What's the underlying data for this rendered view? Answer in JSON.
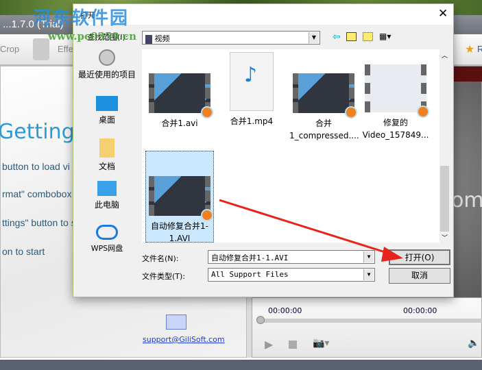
{
  "app": {
    "title": "...1.7.0 (Trial)",
    "toolbar": [
      "Crop",
      "Effect",
      "R"
    ],
    "getting_started": "Getting Started",
    "steps": [
      "button to load vi",
      "rmat\" combobox",
      "ttings\" button to s",
      "on to start"
    ],
    "support_email": "support@GiliSoft.com",
    "time_start": "00:00:00",
    "time_end": "00:00:00",
    "preview_text": "om"
  },
  "watermark": {
    "name": "河东软件园",
    "url": "www.pc0359.cn"
  },
  "dialog": {
    "title": "打开",
    "look_in_label": "查找范围(I):",
    "look_in_value": "视频",
    "places": [
      {
        "label": "最近使用的项目",
        "icon": "recent-icon"
      },
      {
        "label": "桌面",
        "icon": "desktop-icon"
      },
      {
        "label": "文档",
        "icon": "documents-icon"
      },
      {
        "label": "此电脑",
        "icon": "computer-icon"
      },
      {
        "label": "WPS网盘",
        "icon": "cloud-icon"
      }
    ],
    "files": [
      {
        "name": "合并1.avi"
      },
      {
        "name": "合并1.mp4"
      },
      {
        "name": "合并 1_compressed...."
      },
      {
        "name": "修复的 Video_157849..."
      },
      {
        "name": "自动修复合并1-1.AVI",
        "selected": true
      }
    ],
    "filename_label": "文件名(N):",
    "filename_value": "自动修复合并1-1.AVI",
    "filetype_label": "文件类型(T):",
    "filetype_value": "All Support Files",
    "open_label": "打开(O)",
    "cancel_label": "取消"
  },
  "colors": {
    "accent": "#2b9ad8",
    "annotation_arrow": "#e8231c",
    "selection": "#cce8ff"
  }
}
